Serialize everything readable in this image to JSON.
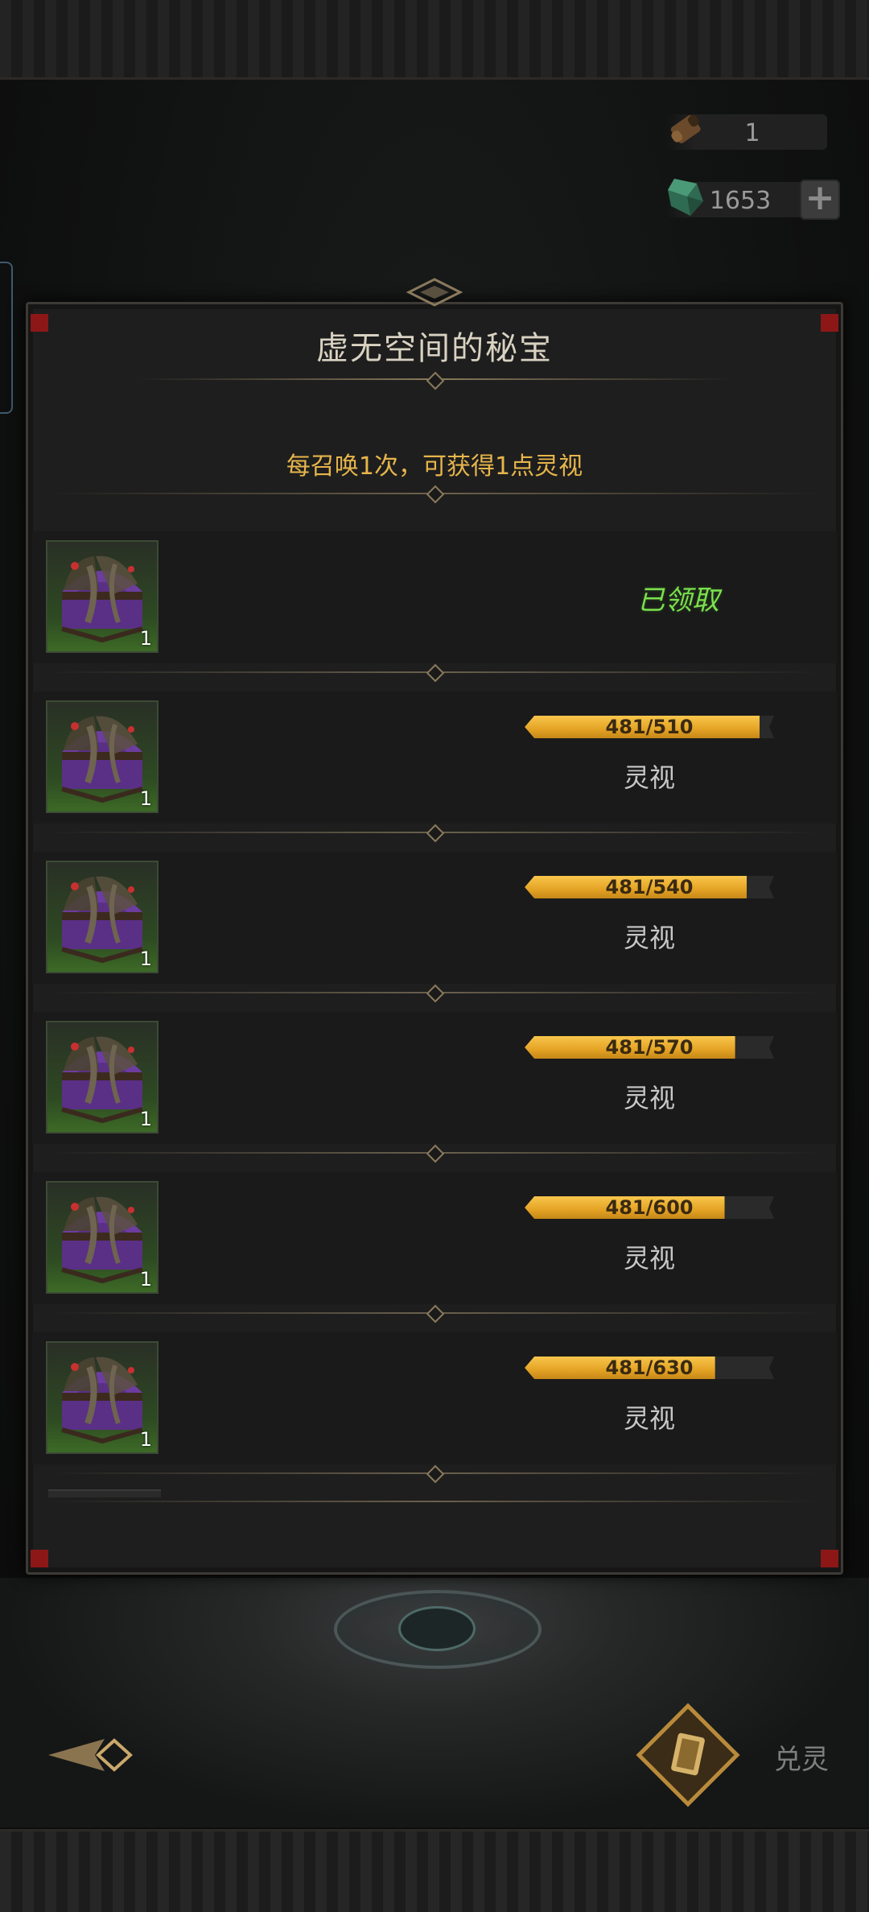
{
  "header": {
    "scroll_count": "1",
    "gem_count": "1653",
    "gem_add_label": "+"
  },
  "panel": {
    "title": "虚无空间的秘宝",
    "subtitle": "每召唤1次，可获得1点灵视"
  },
  "rewards": [
    {
      "qty": "1",
      "status": "已领取",
      "claimed": true
    },
    {
      "qty": "1",
      "progress_text": "481/510",
      "current": 481,
      "target": 510,
      "label": "灵视"
    },
    {
      "qty": "1",
      "progress_text": "481/540",
      "current": 481,
      "target": 540,
      "label": "灵视"
    },
    {
      "qty": "1",
      "progress_text": "481/570",
      "current": 481,
      "target": 570,
      "label": "灵视"
    },
    {
      "qty": "1",
      "progress_text": "481/600",
      "current": 481,
      "target": 600,
      "label": "灵视"
    },
    {
      "qty": "1",
      "progress_text": "481/630",
      "current": 481,
      "target": 630,
      "label": "灵视"
    }
  ],
  "footer": {
    "spirit_label": "兑灵"
  },
  "colors": {
    "accent_gold": "#e7b54b",
    "claimed_green": "#7be04e",
    "bar_fill": "#e4a324",
    "corner_red": "#8d1717"
  }
}
